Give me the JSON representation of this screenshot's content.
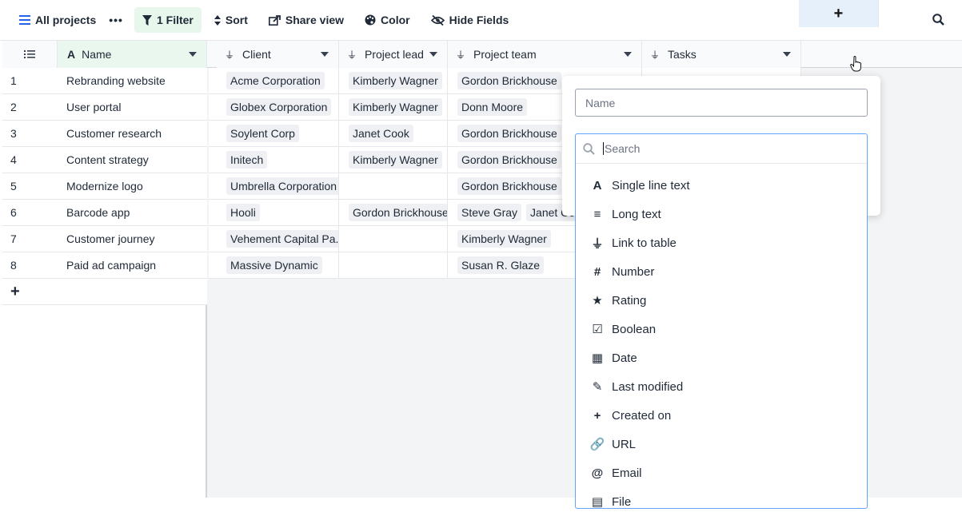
{
  "toolbar": {
    "all_projects": "All projects",
    "more": "•••",
    "filter": "1 Filter",
    "sort": "Sort",
    "share": "Share view",
    "color": "Color",
    "hide": "Hide Fields"
  },
  "columns": {
    "name": "Name",
    "client": "Client",
    "lead": "Project lead",
    "team": "Project team",
    "tasks": "Tasks",
    "add": "+"
  },
  "rows": [
    {
      "num": "1",
      "name": "Rebranding website",
      "client": "Acme Corporation",
      "lead": "Kimberly Wagner",
      "team": [
        "Gordon Brickhouse"
      ]
    },
    {
      "num": "2",
      "name": "User portal",
      "client": "Globex Corporation",
      "lead": "Kimberly Wagner",
      "team": [
        "Donn Moore"
      ]
    },
    {
      "num": "3",
      "name": "Customer research",
      "client": "Soylent Corp",
      "lead": "Janet Cook",
      "team": [
        "Gordon Brickhouse"
      ]
    },
    {
      "num": "4",
      "name": "Content strategy",
      "client": "Initech",
      "lead": "Kimberly Wagner",
      "team": [
        "Gordon Brickhouse"
      ]
    },
    {
      "num": "5",
      "name": "Modernize logo",
      "client": "Umbrella Corporation",
      "lead": "",
      "team": [
        "Gordon Brickhouse"
      ]
    },
    {
      "num": "6",
      "name": "Barcode app",
      "client": "Hooli",
      "lead": "Gordon Brickhouse",
      "team": [
        "Steve Gray",
        "Janet Co"
      ]
    },
    {
      "num": "7",
      "name": "Customer journey",
      "client": "Vehement Capital Pa...",
      "lead": "",
      "team": [
        "Kimberly Wagner"
      ]
    },
    {
      "num": "8",
      "name": "Paid ad campaign",
      "client": "Massive Dynamic",
      "lead": "",
      "team": [
        "Susan R. Glaze"
      ]
    }
  ],
  "add_row": "+",
  "popup": {
    "name_placeholder": "Name",
    "search_placeholder": "Search",
    "types": [
      {
        "label": "Single line text",
        "icon": "A"
      },
      {
        "label": "Long text",
        "icon": "≡"
      },
      {
        "label": "Link to table",
        "icon": "⏚"
      },
      {
        "label": "Number",
        "icon": "#"
      },
      {
        "label": "Rating",
        "icon": "★"
      },
      {
        "label": "Boolean",
        "icon": "☑"
      },
      {
        "label": "Date",
        "icon": "▦"
      },
      {
        "label": "Last modified",
        "icon": "✎"
      },
      {
        "label": "Created on",
        "icon": "+"
      },
      {
        "label": "URL",
        "icon": "🔗"
      },
      {
        "label": "Email",
        "icon": "@"
      },
      {
        "label": "File",
        "icon": "▤"
      }
    ]
  }
}
